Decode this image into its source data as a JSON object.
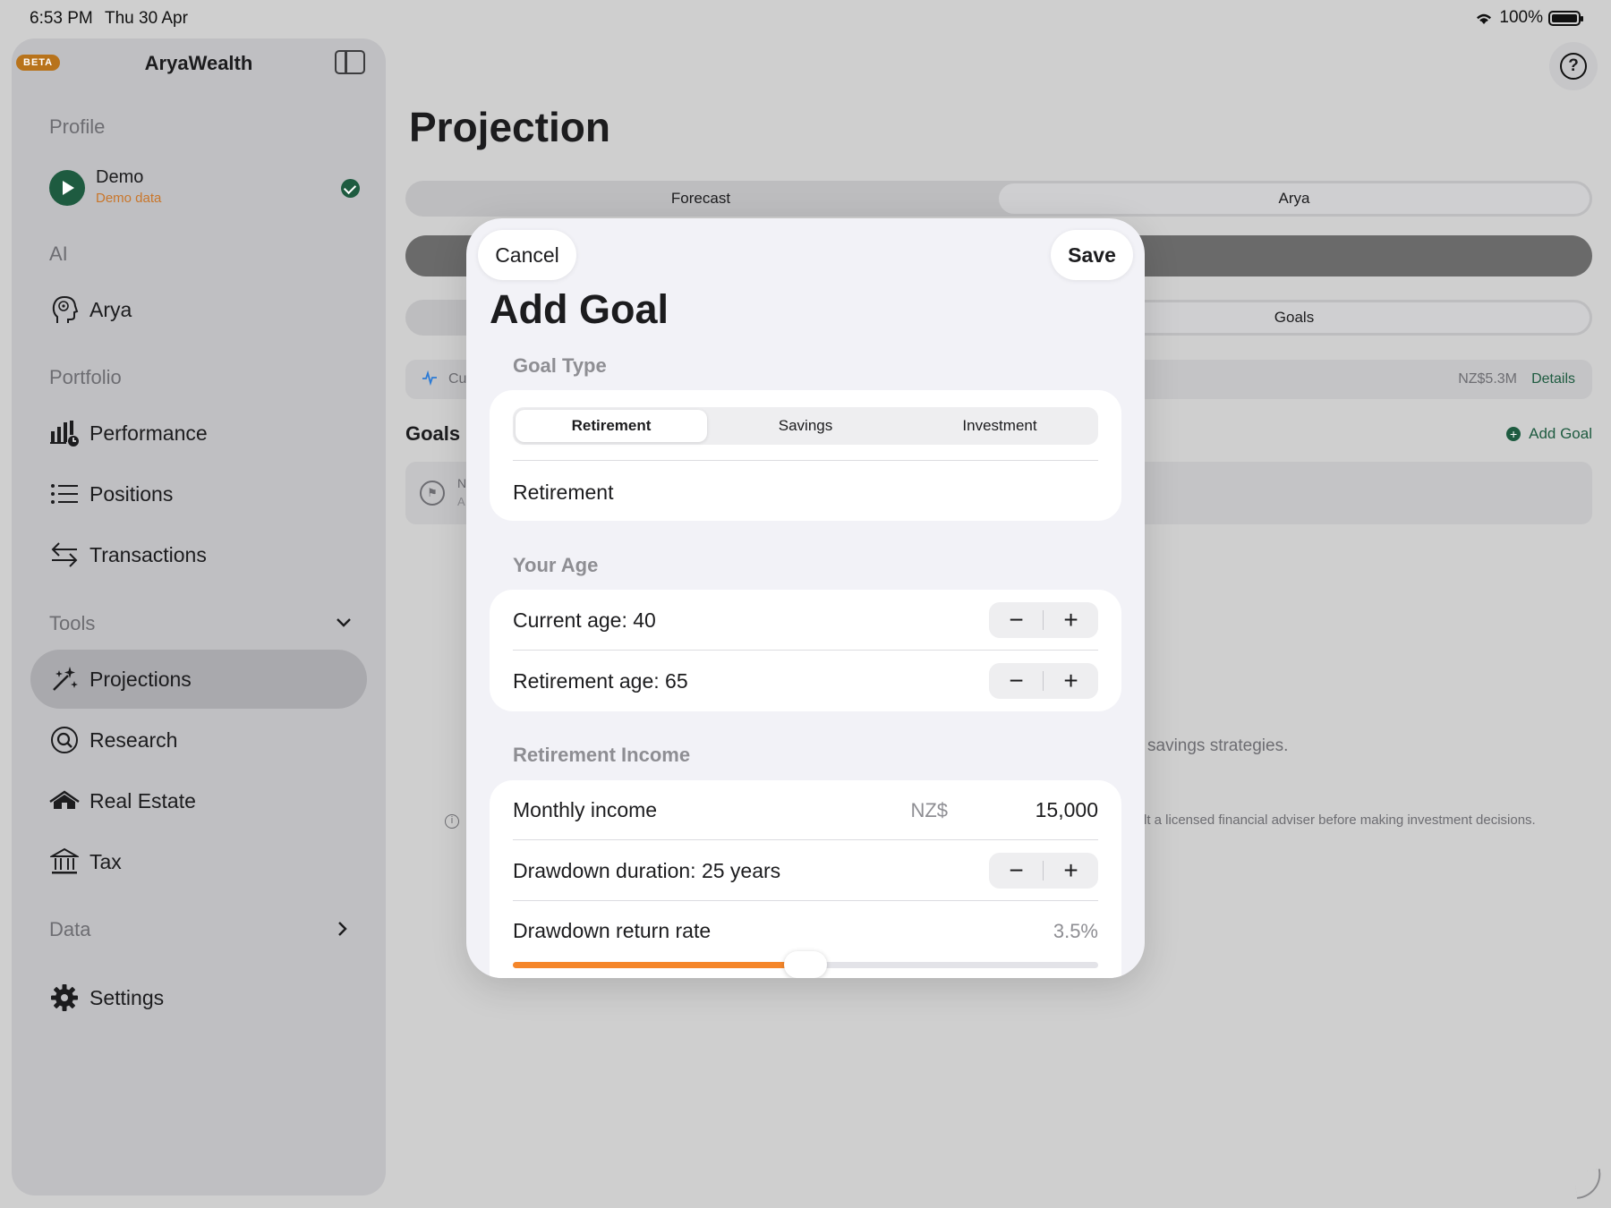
{
  "status_bar": {
    "time": "6:53 PM",
    "date": "Thu 30 Apr",
    "battery": "100%"
  },
  "sidebar": {
    "beta": "BETA",
    "app_title": "AryaWealth",
    "sections": {
      "profile": "Profile",
      "ai": "AI",
      "portfolio": "Portfolio",
      "tools": "Tools",
      "data": "Data"
    },
    "profile": {
      "name": "Demo",
      "subtitle": "Demo data"
    },
    "items": {
      "arya": "Arya",
      "performance": "Performance",
      "positions": "Positions",
      "transactions": "Transactions",
      "projections": "Projections",
      "research": "Research",
      "real_estate": "Real Estate",
      "tax": "Tax",
      "settings": "Settings"
    },
    "active_item": "projections"
  },
  "main": {
    "title": "Projection",
    "tabs": [
      "Forecast",
      "Arya"
    ],
    "selected_tab": "Arya",
    "goals_tab": "Goals",
    "summary": {
      "label_fragment": "Cu",
      "value": "NZ$5.3M",
      "link": "Details"
    },
    "goals_heading": "Goals",
    "add_goal_link": "Add Goal",
    "goal_card": {
      "title_fragment": "N",
      "subtitle_fragment": "A"
    },
    "empty_text_fragment": "savings strategies.",
    "disclaimer_fragment": "lt a licensed financial adviser before making investment decisions."
  },
  "modal": {
    "cancel": "Cancel",
    "save": "Save",
    "title": "Add Goal",
    "goal_type": {
      "section": "Goal Type",
      "options": [
        "Retirement",
        "Savings",
        "Investment"
      ],
      "selected": "Retirement",
      "name_value": "Retirement"
    },
    "age": {
      "section": "Your Age",
      "current_label": "Current age: 40",
      "retirement_label": "Retirement age: 65"
    },
    "income": {
      "section": "Retirement Income",
      "monthly_label": "Monthly income",
      "currency": "NZ$",
      "monthly_value": "15,000",
      "duration_label": "Drawdown duration: 25 years",
      "return_label": "Drawdown return rate",
      "return_value": "3.5%",
      "return_slider_fraction": 0.5
    },
    "accent_color": "#f5862a",
    "brand_color": "#1e5b40"
  }
}
